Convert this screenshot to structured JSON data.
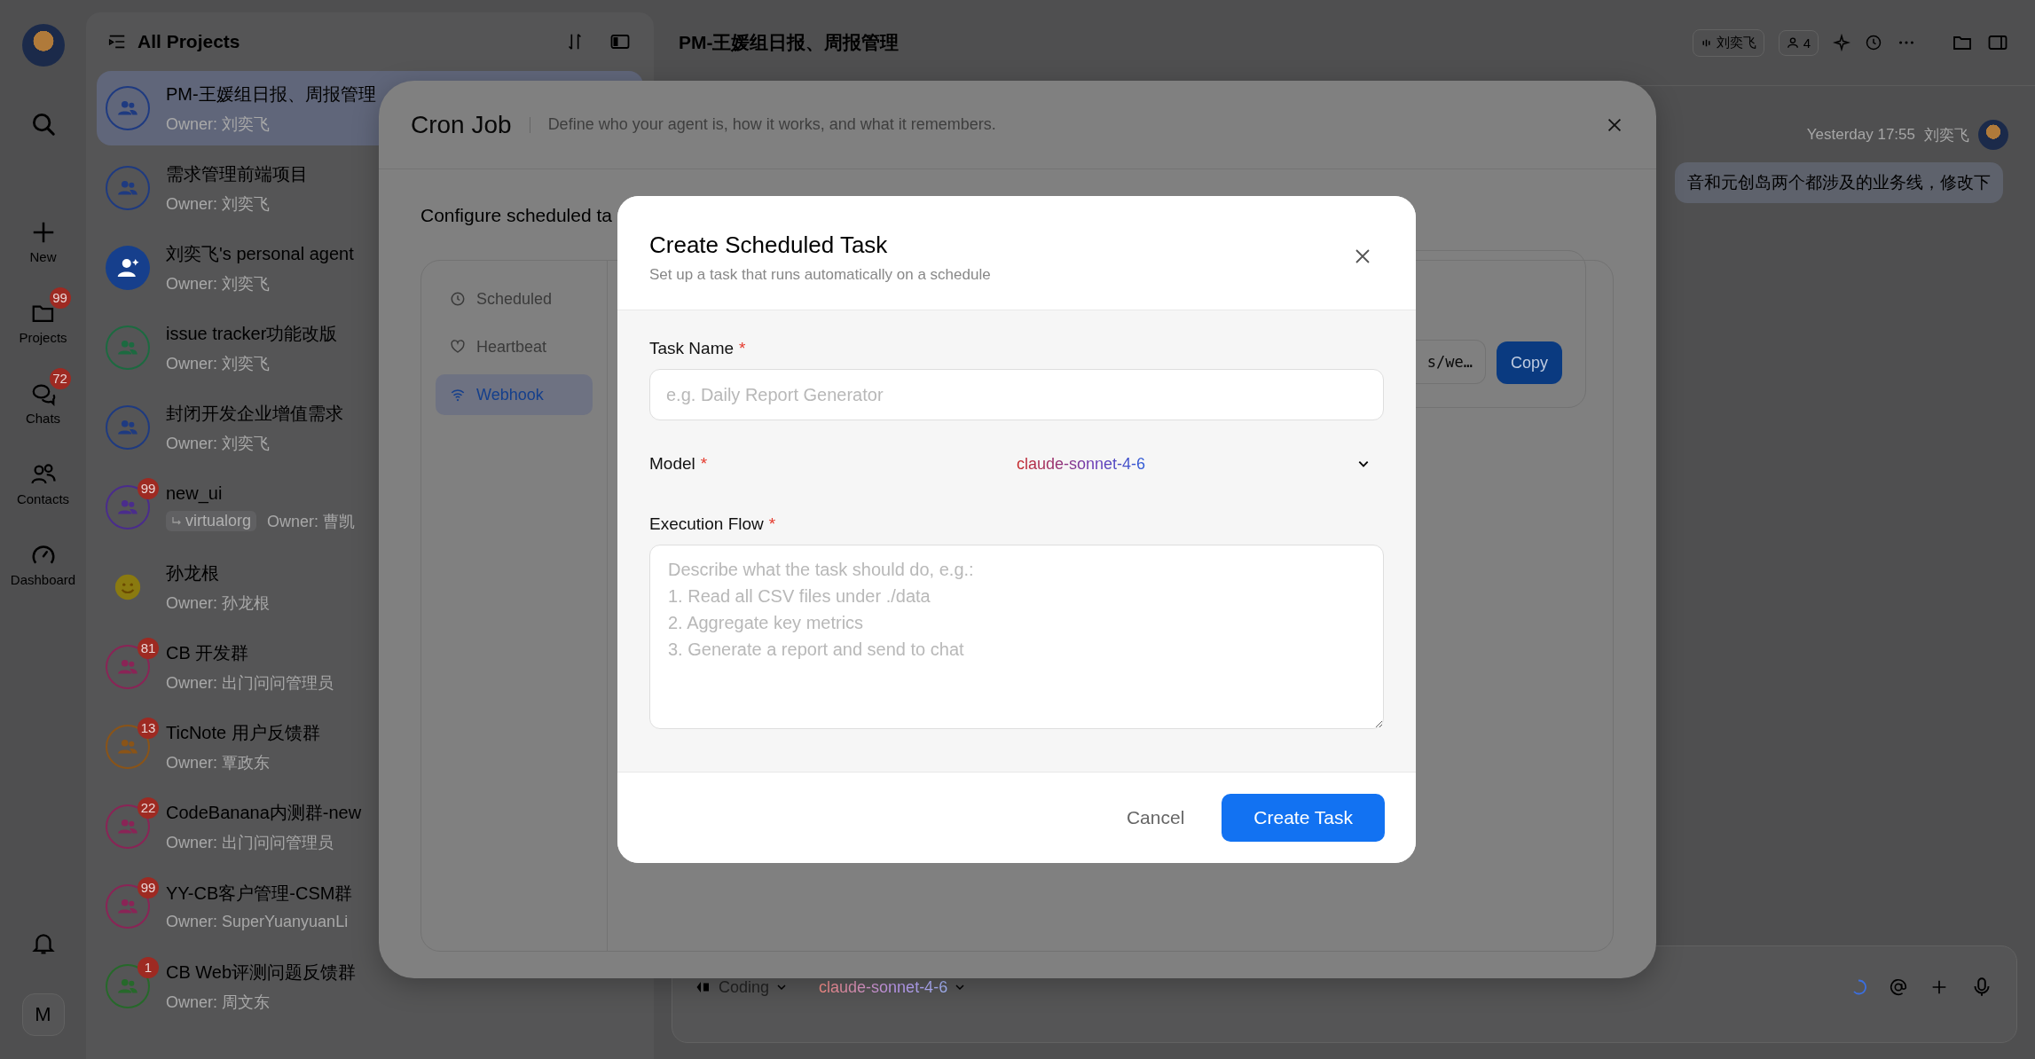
{
  "rail": {
    "nav": [
      {
        "label": "New"
      },
      {
        "label": "Projects",
        "badge": "99"
      },
      {
        "label": "Chats",
        "badge": "72"
      },
      {
        "label": "Contacts"
      },
      {
        "label": "Dashboard"
      }
    ],
    "user_initial": "M"
  },
  "projects": {
    "title": "All Projects",
    "items": [
      {
        "kind": "group",
        "color": "#1e3a80",
        "title": "PM-王媛组日报、周报管理",
        "owner": "Owner: 刘奕飞",
        "selected": true
      },
      {
        "kind": "group",
        "color": "#1e3a80",
        "title": "需求管理前端项目",
        "owner": "Owner: 刘奕飞",
        "selected": false
      },
      {
        "kind": "personal",
        "color": "#163f8c",
        "title": "刘奕飞's personal agent",
        "owner": "Owner: 刘奕飞",
        "selected": false
      },
      {
        "kind": "group",
        "color": "#1c6a40",
        "title": "issue tracker功能改版",
        "owner": "Owner: 刘奕飞",
        "selected": false
      },
      {
        "kind": "group",
        "color": "#1e3a80",
        "title": "封闭开发企业增值需求",
        "owner": "Owner: 刘奕飞",
        "selected": false
      },
      {
        "kind": "group",
        "color": "#4a2c8c",
        "title": "new_ui",
        "badge": "99",
        "tag": "virtualorg",
        "owner": "Owner: 曹凯",
        "selected": false
      },
      {
        "kind": "emoji",
        "color": "#8a7a10",
        "title": "孙龙根",
        "owner": "Owner: 孙龙根",
        "selected": false
      },
      {
        "kind": "group",
        "color": "#8a2456",
        "title": "CB 开发群",
        "badge": "81",
        "owner": "Owner: 出门问问管理员",
        "selected": false
      },
      {
        "kind": "group",
        "color": "#8a5418",
        "title": "TicNote 用户反馈群",
        "badge": "13",
        "owner": "Owner: 覃政东",
        "selected": false
      },
      {
        "kind": "group",
        "color": "#8a2456",
        "title": "CodeBanana内测群-new",
        "badge": "22",
        "owner": "Owner: 出门问问管理员",
        "selected": false
      },
      {
        "kind": "group",
        "color": "#8a2456",
        "title": "YY-CB客户管理-CSM群",
        "badge": "99",
        "owner": "Owner: SuperYuanyuanLi",
        "selected": false
      },
      {
        "kind": "group",
        "color": "#26692a",
        "title": "CB Web评测问题反馈群",
        "badge": "1",
        "owner": "Owner: 周文东",
        "selected": false
      }
    ]
  },
  "chat": {
    "title": "PM-王媛组日报、周报管理",
    "speaker": "刘奕飞",
    "member_count": "4",
    "message": {
      "time": "Yesterday 17:55",
      "author": "刘奕飞",
      "text": "音和元创岛两个都涉及的业务线，修改下"
    },
    "composer": {
      "mode": "Coding",
      "model": "claude-sonnet-4-6"
    }
  },
  "cron_job": {
    "title": "Cron Job",
    "subtitle": "Define who your agent is, how it works, and what it remembers.",
    "intro": "Configure scheduled ta",
    "tabs": [
      {
        "label": "Scheduled",
        "selected": false
      },
      {
        "label": "Heartbeat",
        "selected": false
      },
      {
        "label": "Webhook",
        "selected": true
      }
    ],
    "webhook": {
      "url": "s/we…",
      "copy": "Copy"
    }
  },
  "dialog": {
    "title": "Create Scheduled Task",
    "subtitle": "Set up a task that runs automatically on a schedule",
    "fields": [
      {
        "kind": "text",
        "label": "Task Name",
        "asterisk": "*",
        "placeholder": "e.g. Daily Report Generator"
      },
      {
        "kind": "select",
        "label": "Model",
        "asterisk": "*",
        "value": "claude-sonnet-4-6"
      },
      {
        "kind": "textarea",
        "label": "Execution Flow",
        "asterisk": "*",
        "placeholder": "Describe what the task should do, e.g.:\n1. Read all CSV files under ./data\n2. Aggregate key metrics\n3. Generate a report and send to chat"
      }
    ],
    "buttons": [
      {
        "kind": "secondary",
        "label": "Cancel"
      },
      {
        "kind": "primary",
        "label": "Create Task"
      }
    ]
  }
}
